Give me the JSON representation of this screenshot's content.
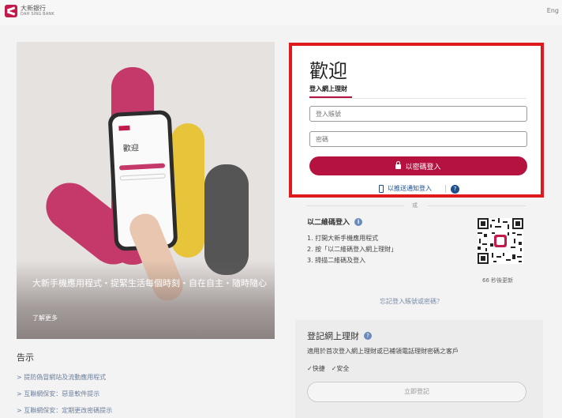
{
  "header": {
    "logo_cn": "大新銀行",
    "logo_en": "DAH SING BANK",
    "language": "Eng"
  },
  "hero": {
    "caption": "大新手機應用程式・捉緊生活每個時刻・自在自主・隨時隨心",
    "learn_more": "了解更多",
    "phone_title": "歡迎"
  },
  "login": {
    "title": "歡迎",
    "tab": "登入網上理財",
    "account_placeholder": "登入賬號",
    "password_placeholder": "密碼",
    "login_button": "以密碼登入",
    "push_login": "以推送通知登入",
    "help": "?"
  },
  "qr": {
    "divider": "或",
    "title": "以二維碼登入",
    "info": "i",
    "steps": [
      "1. 打開大新手機應用程式",
      "2. 按「以二維碼登入網上理財」",
      "3. 掃描二維碼及登入"
    ],
    "timer": "66 秒後更新"
  },
  "forgot": "忘記登入賬號或密碼？",
  "register": {
    "title": "登記網上理財",
    "info": "?",
    "description": "適用於首次登入網上理財或已補領電話理財密碼之客戶",
    "features": [
      "✓快捷",
      "✓安全"
    ],
    "button": "立即登記"
  },
  "notices": {
    "title": "告示",
    "items": [
      "> 提防偽冒網站及流動應用程式",
      "> 互聯網保安：惡意軟件提示",
      "> 互聯網保安：定期更改密碼提示"
    ]
  },
  "colors": {
    "brand": "#b5123f",
    "highlight_border": "#e01a1a",
    "link": "#1f4f8f"
  }
}
